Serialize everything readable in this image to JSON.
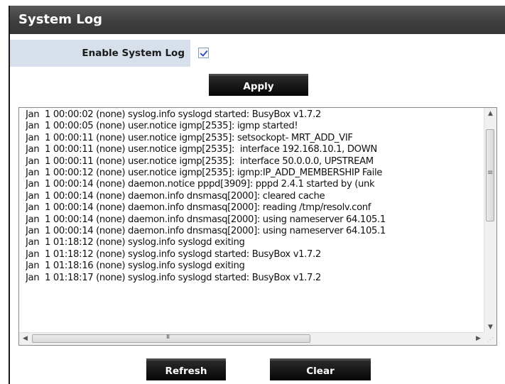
{
  "header": {
    "title": "System Log"
  },
  "enable": {
    "label": "Enable System Log",
    "checked": true
  },
  "buttons": {
    "apply": "Apply",
    "refresh": "Refresh",
    "clear": "Clear"
  },
  "log": {
    "text": "Jan  1 00:00:02 (none) syslog.info syslogd started: BusyBox v1.7.2\nJan  1 00:00:05 (none) user.notice igmp[2535]: igmp started!\nJan  1 00:00:11 (none) user.notice igmp[2535]: setsockopt- MRT_ADD_VIF\nJan  1 00:00:11 (none) user.notice igmp[2535]:  interface 192.168.10.1, DOWN\nJan  1 00:00:11 (none) user.notice igmp[2535]:  interface 50.0.0.0, UPSTREAM\nJan  1 00:00:12 (none) user.notice igmp[2535]: igmp:IP_ADD_MEMBERSHIP Faile\nJan  1 00:00:14 (none) daemon.notice pppd[3909]: pppd 2.4.1 started by (unk\nJan  1 00:00:14 (none) daemon.info dnsmasq[2000]: cleared cache\nJan  1 00:00:14 (none) daemon.info dnsmasq[2000]: reading /tmp/resolv.conf\nJan  1 00:00:14 (none) daemon.info dnsmasq[2000]: using nameserver 64.105.1\nJan  1 00:00:14 (none) daemon.info dnsmasq[2000]: using nameserver 64.105.1\nJan  1 01:18:12 (none) syslog.info syslogd exiting\nJan  1 01:18:12 (none) syslog.info syslogd started: BusyBox v1.7.2\nJan  1 01:18:16 (none) syslog.info syslogd exiting\nJan  1 01:18:17 (none) syslog.info syslogd started: BusyBox v1.7.2"
  },
  "icons": {
    "up": "scroll-up-arrow-icon",
    "down": "scroll-down-arrow-icon",
    "left": "scroll-left-arrow-icon",
    "right": "scroll-right-arrow-icon"
  }
}
